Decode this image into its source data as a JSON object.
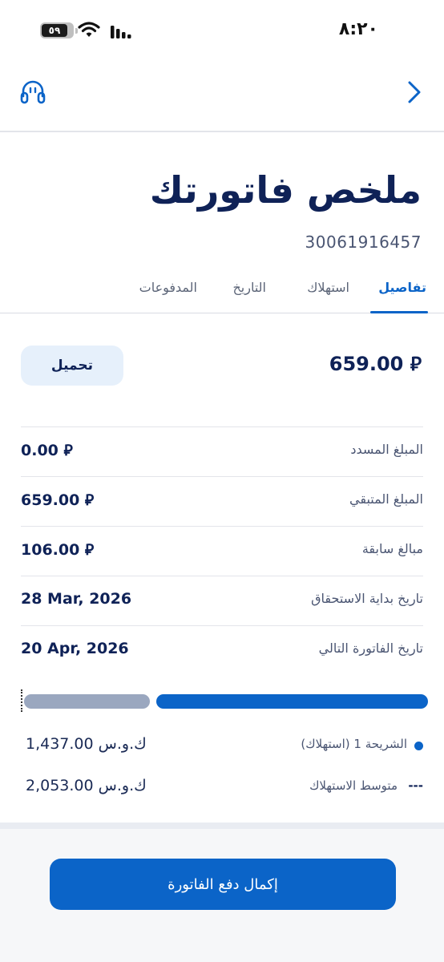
{
  "status_bar": {
    "time": "٨:٢٠",
    "battery": "٥٩"
  },
  "header": {
    "left_icon": "headset-icon",
    "right_icon": "chevron-right-icon"
  },
  "title": "ملخص فاتورتك",
  "account_number": "30061916457",
  "tabs": [
    {
      "label": "تفاصيل",
      "active": true
    },
    {
      "label": "استهلاك",
      "active": false
    },
    {
      "label": "التاريخ",
      "active": false
    },
    {
      "label": "المدفوعات",
      "active": false
    }
  ],
  "summary": {
    "total": "659.00 ⃁",
    "download_label": "تحميل"
  },
  "details": [
    {
      "label": "المبلغ المسدد",
      "value": "0.00 ⃁"
    },
    {
      "label": "المبلغ المتبقي",
      "value": "659.00 ⃁"
    },
    {
      "label": "مبالغ سابقة",
      "value": "106.00 ⃁"
    },
    {
      "label": "تاريخ بداية الاستحقاق",
      "value": "28 Mar, 2026"
    },
    {
      "label": "تاريخ الفاتورة التالي",
      "value": "20 Apr, 2026"
    }
  ],
  "usage": {
    "current_fraction": 0.68,
    "legend": [
      {
        "label": "الشريحة 1 (استهلاك)",
        "value": "1,437.00 ك.و.س",
        "marker": "dot"
      },
      {
        "label": "متوسط الاستهلاك",
        "value": "2,053.00 ك.و.س",
        "marker": "dash"
      }
    ]
  },
  "colors": {
    "primary": "#0b64c8",
    "navy": "#0f2257",
    "grey_bar": "#9aa7bf",
    "light_button": "#e6f0fb"
  },
  "pay_button": {
    "label": "إكمال دفع الفاتورة"
  }
}
